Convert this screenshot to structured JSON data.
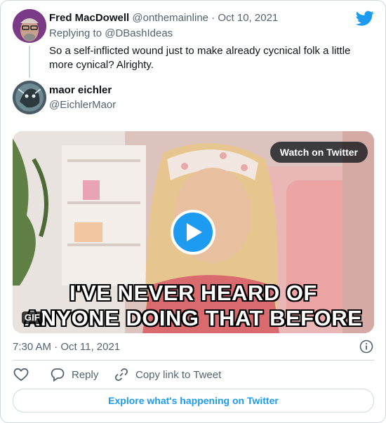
{
  "parent_tweet": {
    "author_name": "Fred MacDowell",
    "author_handle": "@onthemainline",
    "separator": "·",
    "date": "Oct 10, 2021",
    "replying_to_label": "Replying to",
    "replying_to_handle": "@DBashIdeas",
    "text": "So a self-inflicted wound just to make already cycnical folk a little more cynical? Alrighty."
  },
  "reply_tweet": {
    "author_name": "maor eichler",
    "author_handle": "@EichlerMaor",
    "media": {
      "watch_label": "Watch on Twitter",
      "caption_line1": "I'VE NEVER HEARD OF",
      "caption_line2": "ANYONE DOING THAT BEFORE",
      "badge": "GIF"
    },
    "timestamp": "7:30 AM · Oct 11, 2021"
  },
  "actions": {
    "reply_label": "Reply",
    "copy_label": "Copy link to Tweet"
  },
  "explore_label": "Explore what's happening on Twitter",
  "colors": {
    "accent": "#1d9bf0",
    "text": "#0f1419",
    "muted": "#536471",
    "border": "#cfd9de"
  },
  "icons": {
    "brand": "twitter-bird-icon",
    "info": "info-icon",
    "like": "heart-icon",
    "reply": "reply-bubble-icon",
    "copy": "link-icon",
    "play": "play-icon"
  }
}
